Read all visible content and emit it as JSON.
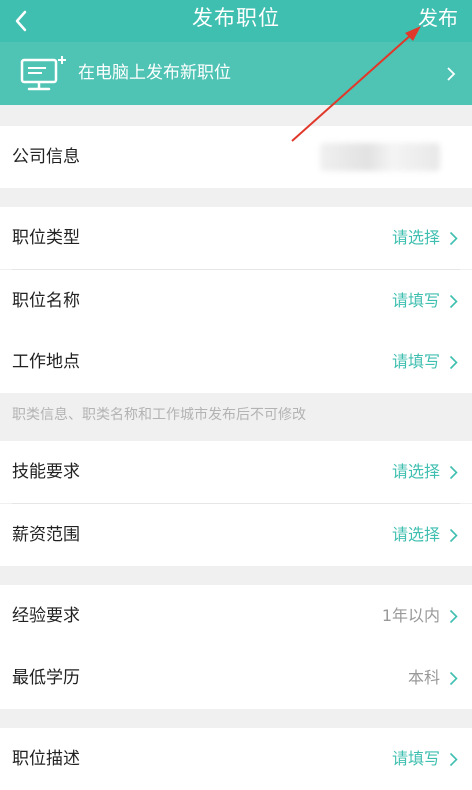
{
  "header": {
    "title": "发布职位",
    "publish_label": "发布"
  },
  "banner": {
    "text": "在电脑上发布新职位"
  },
  "company": {
    "label": "公司信息"
  },
  "section1": [
    {
      "label": "职位类型",
      "value": "请选择"
    },
    {
      "label": "职位名称",
      "value": "请填写"
    },
    {
      "label": "工作地点",
      "value": "请填写"
    }
  ],
  "notice": "职类信息、职类名称和工作城市发布后不可修改",
  "section2": [
    {
      "label": "技能要求",
      "value": "请选择"
    },
    {
      "label": "薪资范围",
      "value": "请选择"
    }
  ],
  "section3": [
    {
      "label": "经验要求",
      "value": "1年以内"
    },
    {
      "label": "最低学历",
      "value": "本科"
    }
  ],
  "section4": [
    {
      "label": "职位描述",
      "value": "请填写"
    }
  ],
  "colors": {
    "accent": "#3fbfb0",
    "arrow": "#e0392b"
  }
}
